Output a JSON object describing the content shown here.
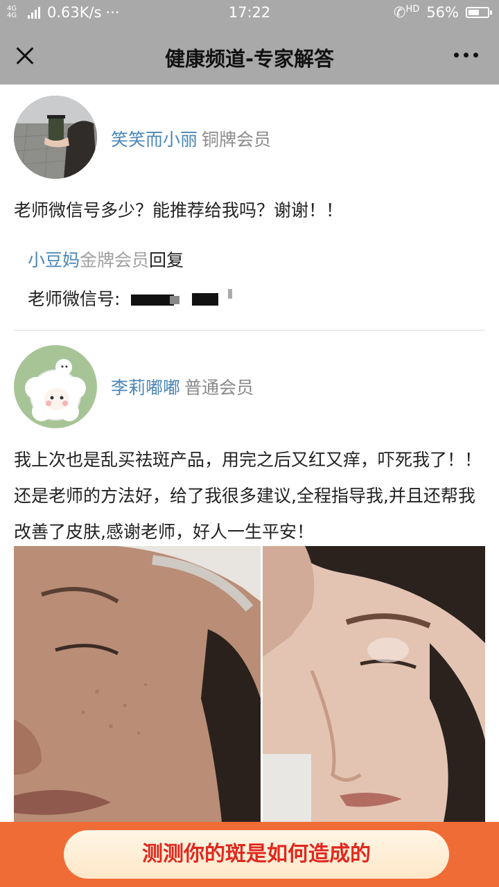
{
  "status_bar": {
    "network": "4G 4G",
    "speed": "0.63K/s",
    "dots": "···",
    "time": "17:22",
    "hd": "HD",
    "battery": "56%",
    "battery_level": 0.56
  },
  "nav": {
    "title": "健康频道-专家解答"
  },
  "posts": [
    {
      "user": "笑笑而小丽",
      "level": "铜牌会员",
      "text": "老师微信号多少？能推荐给我吗？谢谢！！",
      "reply": {
        "user": "小豆妈",
        "level": "金牌会员",
        "action": "回复",
        "text": "老师微信号:"
      }
    },
    {
      "user": "李莉嘟嘟",
      "level": "普通会员",
      "text": "我上次也是乱买祛斑产品，用完之后又红又痒，吓死我了！！还是老师的方法好，给了我很多建议,全程指导我,并且还帮我改善了皮肤,感谢老师，好人一生平安！"
    }
  ],
  "banner": {
    "label": "测测你的斑是如何造成的"
  },
  "colors": {
    "username": "#4a86b8",
    "banner_bg": "#f06c36",
    "banner_text": "#e0281e"
  }
}
